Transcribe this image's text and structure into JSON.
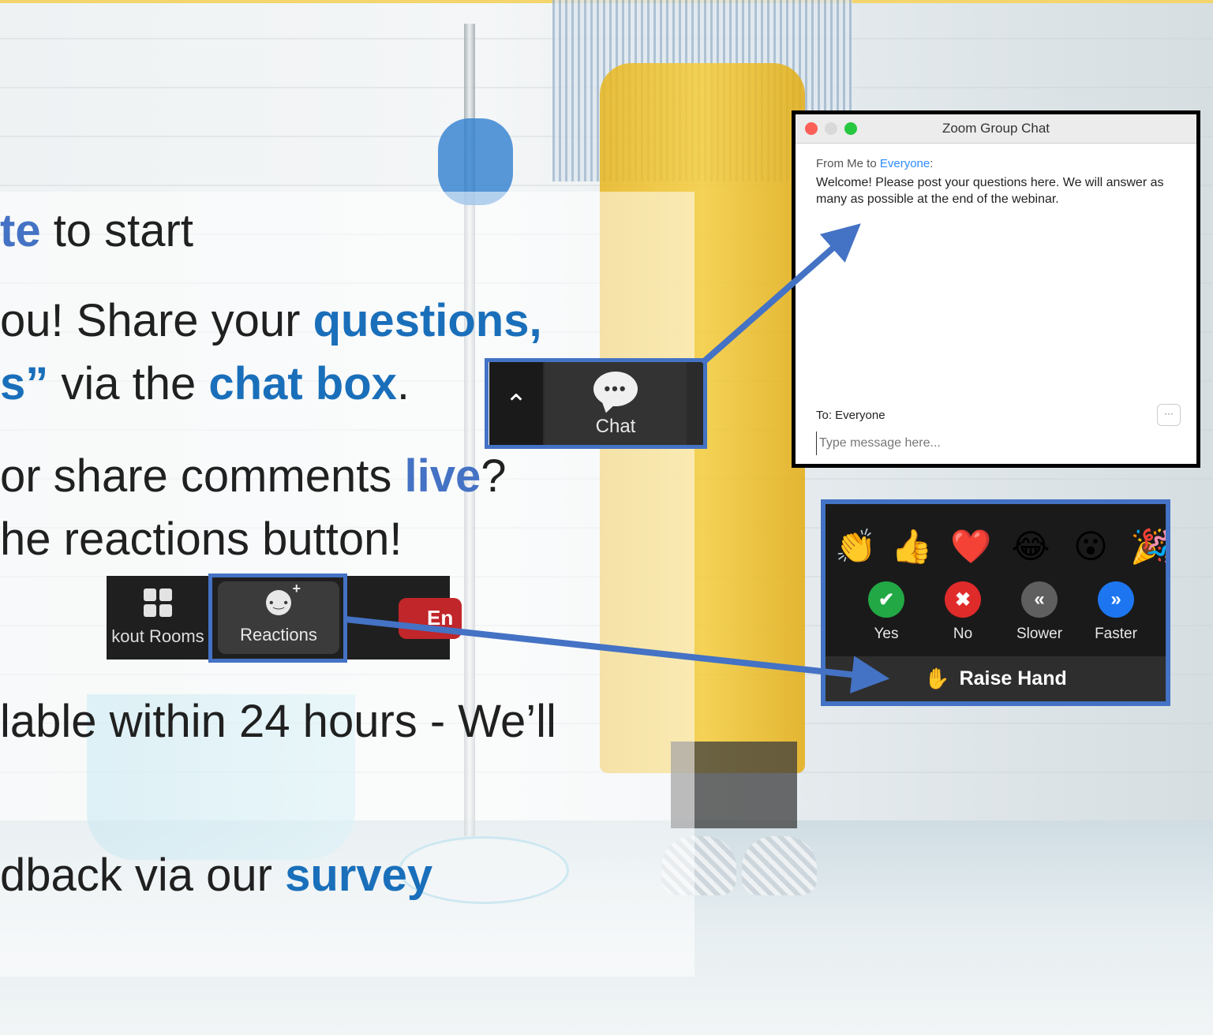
{
  "slide": {
    "line1": {
      "highlight": "te",
      "rest": " to start"
    },
    "line2": {
      "text": "ou! Share your ",
      "highlight": "questions,"
    },
    "line3": {
      "highlight": "s”",
      "text": " via the ",
      "highlight2": "chat box",
      "end": "."
    },
    "line4": {
      "text": "or share comments ",
      "highlight": "live",
      "end": "?"
    },
    "line5": {
      "text": "he reactions button!"
    },
    "line6": {
      "text": "lable within 24 hours - We’ll"
    },
    "line7": {
      "text": "dback via our ",
      "highlight": "survey"
    }
  },
  "chat_toolbar": {
    "caret_icon": "chevron-up-icon",
    "caret_glyph": "⌃",
    "chat_label": "Chat",
    "chat_icon": "chat-bubble-icon",
    "bubble_glyph": "•••"
  },
  "zoom_toolbar": {
    "breakout_label": "kout Rooms",
    "reactions_label": "Reactions",
    "end_label": "En"
  },
  "chat_window": {
    "title": "Zoom Group Chat",
    "from_prefix": "From Me to ",
    "from_target": "Everyone",
    "from_suffix": ":",
    "message": "Welcome!  Please post your questions here. We will answer as many as possible at the end of the webinar.",
    "to_label": "To: Everyone",
    "more_label": "···",
    "input_placeholder": "Type message here..."
  },
  "reactions_panel": {
    "emojis": [
      {
        "icon": "clapping-hands-icon",
        "glyph": "👏"
      },
      {
        "icon": "thumbs-up-icon",
        "glyph": "👍"
      },
      {
        "icon": "heart-icon",
        "glyph": "❤️"
      },
      {
        "icon": "tears-of-joy-icon",
        "glyph": "😂"
      },
      {
        "icon": "surprised-face-icon",
        "glyph": "😮"
      },
      {
        "icon": "party-popper-icon",
        "glyph": "🎉"
      }
    ],
    "feedback": [
      {
        "label": "Yes",
        "icon": "check-icon",
        "glyph": "✔",
        "color": "#22a845"
      },
      {
        "label": "No",
        "icon": "x-icon",
        "glyph": "✖",
        "color": "#e02b2b"
      },
      {
        "label": "Slower",
        "icon": "rewind-icon",
        "glyph": "«",
        "color": "#5f5f5f"
      },
      {
        "label": "Faster",
        "icon": "fast-forward-icon",
        "glyph": "»",
        "color": "#1d76f0"
      }
    ],
    "raise_hand_label": "Raise Hand",
    "raise_hand_glyph": "✋"
  },
  "colors": {
    "accent": "#4472c4",
    "highlight_text": "#1a6fba",
    "end_button": "#c0262a"
  }
}
